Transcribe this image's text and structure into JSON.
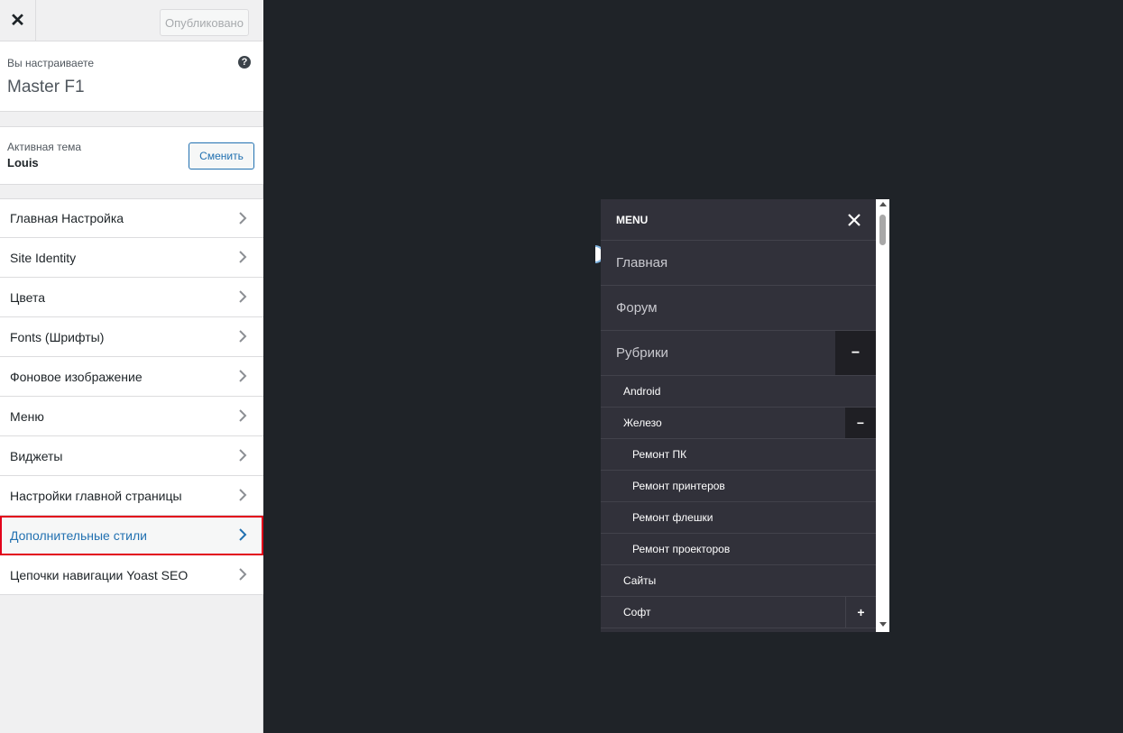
{
  "topbar": {
    "close_label": "✕",
    "publish_label": "Опубликовано"
  },
  "info": {
    "label": "Вы настраиваете",
    "title": "Master F1",
    "help_icon": "?"
  },
  "theme": {
    "label": "Активная тема",
    "name": "Louis",
    "change_label": "Сменить"
  },
  "nav": {
    "items": [
      {
        "label": "Главная Настройка"
      },
      {
        "label": "Site Identity"
      },
      {
        "label": "Цвета"
      },
      {
        "label": "Fonts (Шрифты)"
      },
      {
        "label": "Фоновое изображение"
      },
      {
        "label": "Меню"
      },
      {
        "label": "Виджеты"
      },
      {
        "label": "Настройки главной страницы"
      },
      {
        "label": "Дополнительные стили"
      },
      {
        "label": "Цепочки навигации Yoast SEO"
      }
    ],
    "active_index": 8
  },
  "menu": {
    "title": "MENU",
    "items": [
      {
        "label": "Главная"
      },
      {
        "label": "Форум"
      },
      {
        "label": "Рубрики",
        "toggle": "−"
      },
      {
        "label": "Android"
      },
      {
        "label": "Железо",
        "toggle": "−"
      },
      {
        "label": "Ремонт ПК"
      },
      {
        "label": "Ремонт принтеров"
      },
      {
        "label": "Ремонт флешки"
      },
      {
        "label": "Ремонт проекторов"
      },
      {
        "label": "Сайты"
      },
      {
        "label": "Софт",
        "toggle": "+"
      }
    ]
  },
  "colors": {
    "accent": "#2271b1",
    "highlight": "#e2001a",
    "menu_bg": "#31313a",
    "preview_bg": "#1f2328"
  }
}
